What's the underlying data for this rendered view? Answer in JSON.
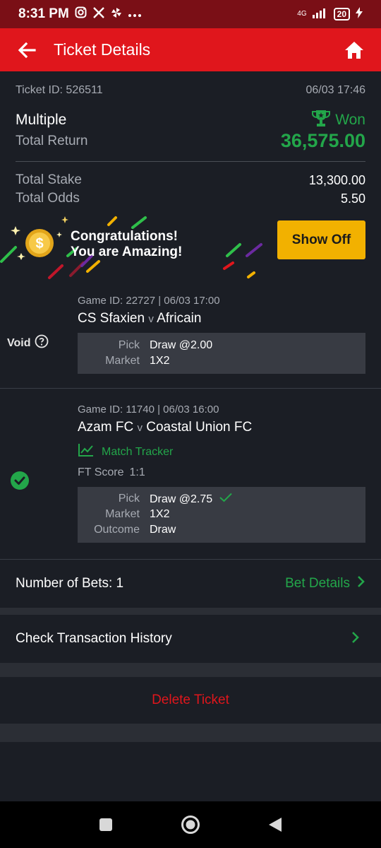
{
  "status_bar": {
    "time": "8:31 PM",
    "network": "4G",
    "battery": "20",
    "battery_level_percent": 20,
    "icons": [
      "instagram-icon",
      "x-icon",
      "pinwheel-icon",
      "more-dots-icon",
      "signal-icon",
      "battery-icon",
      "charging-icon"
    ]
  },
  "header": {
    "title": "Ticket Details",
    "back_icon": "arrow-left-icon",
    "home_icon": "home-icon"
  },
  "ticket": {
    "id_label": "Ticket ID: 526511",
    "datetime": "06/03 17:46",
    "type": "Multiple",
    "status": "Won",
    "total_return_label": "Total Return",
    "total_return": "36,575.00",
    "total_stake_label": "Total Stake",
    "total_stake": "13,300.00",
    "total_odds_label": "Total Odds",
    "total_odds": "5.50"
  },
  "banner": {
    "line1": "Congratulations!",
    "line2": "You are Amazing!",
    "button": "Show Off"
  },
  "selections": [
    {
      "status": "Void",
      "game_id": "Game ID: 22727 | 06/03 17:00",
      "home": "CS Sfaxien",
      "vs": "v",
      "away": "Africain",
      "pick_label": "Pick",
      "pick": "Draw @2.00",
      "market_label": "Market",
      "market": "1X2"
    },
    {
      "status_icon": "check-circle-icon",
      "game_id": "Game ID: 11740 | 06/03 16:00",
      "home": "Azam FC",
      "vs": "v",
      "away": "Coastal Union FC",
      "tracker": "Match Tracker",
      "ft_label": "FT Score",
      "ft_score": "1:1",
      "pick_label": "Pick",
      "pick": "Draw @2.75",
      "market_label": "Market",
      "market": "1X2",
      "outcome_label": "Outcome",
      "outcome": "Draw"
    }
  ],
  "footer": {
    "bets_label": "Number of Bets: 1",
    "bet_details": "Bet Details",
    "transaction_history": "Check Transaction History",
    "delete": "Delete Ticket"
  },
  "colors": {
    "accent_red": "#e0161c",
    "won_green": "#23a64a",
    "show_off_yellow": "#f2b100",
    "background": "#1b1e25"
  }
}
